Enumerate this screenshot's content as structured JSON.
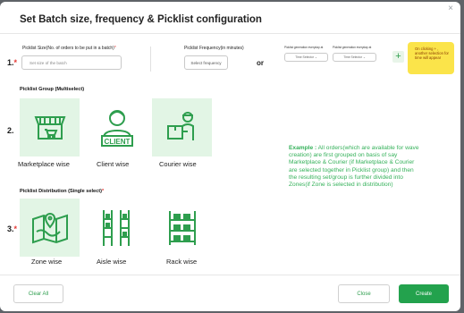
{
  "modal": {
    "title": "Set Batch size,  frequency & Picklist configuration",
    "close_icon": "×"
  },
  "section1": {
    "number": "1.",
    "required_mark": "*",
    "size_label": "Picklist Size(No. of orders to be put in a batch)",
    "size_placeholder": "Set size of the batch",
    "frequency_label": "Picklist Frequency(in minutes)",
    "frequency_button": "Select frequency",
    "or_text": "or",
    "time_label_1": "Picklist generation everyday at",
    "time_label_2": "Picklist generation everyday at",
    "time_select_1": "Time Selector",
    "time_select_2": "Time Selector",
    "add_icon": "+",
    "tooltip": "On clicking + , another selection for time will appear"
  },
  "section2": {
    "number": "2.",
    "title": "Picklist Group (Multiselect)",
    "options": [
      {
        "label": "Marketplace wise",
        "icon": "marketplace-icon"
      },
      {
        "label": "Client wise",
        "icon": "client-icon",
        "badge": "CLIENT"
      },
      {
        "label": "Courier wise",
        "icon": "courier-icon"
      }
    ]
  },
  "example": {
    "bold": "Example :",
    "text": " All orders(which are available for wave creation) are first grouped on basis of say Marketplace & Courier (if Marketplace & Courier are selected together in Picklist group) and then the resulting set/group is further divided into Zones(if Zone is selected in distribution)"
  },
  "section3": {
    "number": "3.",
    "required_mark": "*",
    "title": "Picklist Distribution (Single select)",
    "options": [
      {
        "label": "Zone wise",
        "icon": "zone-map-icon"
      },
      {
        "label": "Aisle wise",
        "icon": "aisle-icon"
      },
      {
        "label": "Rack wise",
        "icon": "rack-icon"
      }
    ]
  },
  "footer": {
    "clear_all": "Clear All",
    "close": "Close",
    "create": "Create"
  },
  "colors": {
    "accent": "#23a24d",
    "card_bg": "#e2f5e5",
    "tooltip_bg": "#fbe44a",
    "required": "#e53935"
  }
}
